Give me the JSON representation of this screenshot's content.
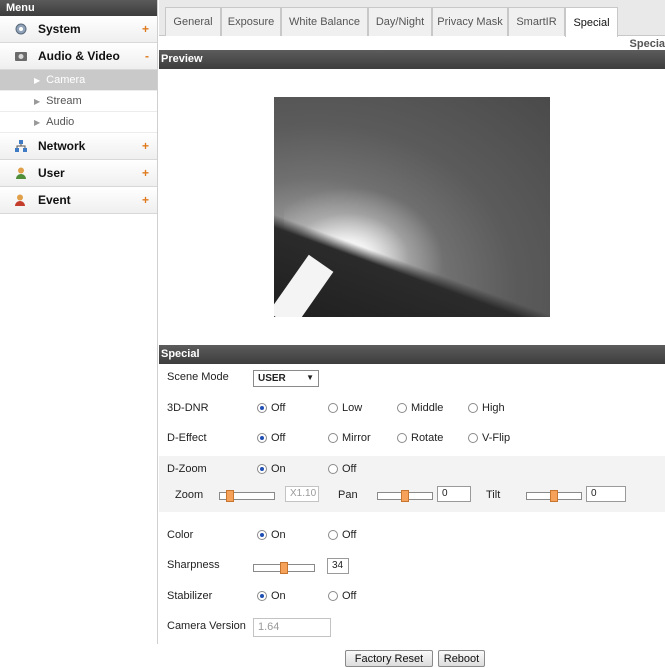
{
  "sidebar": {
    "title": "Menu",
    "items": [
      {
        "label": "System",
        "icon": "gear-icon",
        "sign": "+"
      },
      {
        "label": "Audio & Video",
        "icon": "camera-icon",
        "sign": "-"
      },
      {
        "label": "Network",
        "icon": "network-icon",
        "sign": "+"
      },
      {
        "label": "User",
        "icon": "user-icon",
        "sign": "+"
      },
      {
        "label": "Event",
        "icon": "event-icon",
        "sign": "+"
      }
    ],
    "subitems": [
      "Camera",
      "Stream",
      "Audio"
    ]
  },
  "tabs": [
    "General",
    "Exposure",
    "White Balance",
    "Day/Night",
    "Privacy Mask",
    "SmartIR",
    "Special"
  ],
  "page_title": "Specia",
  "preview": {
    "title": "Preview"
  },
  "special": {
    "title": "Special",
    "scene_mode": {
      "label": "Scene Mode",
      "value": "USER"
    },
    "dnr": {
      "label": "3D-DNR",
      "options": [
        "Off",
        "Low",
        "Middle",
        "High"
      ]
    },
    "deffect": {
      "label": "D-Effect",
      "options": [
        "Off",
        "Mirror",
        "Rotate",
        "V-Flip"
      ]
    },
    "dzoom": {
      "label": "D-Zoom",
      "on": "On",
      "off": "Off"
    },
    "zoom": {
      "label": "Zoom",
      "value": "X1.10",
      "level": 0.12
    },
    "pan": {
      "label": "Pan",
      "value": "0",
      "level": 0.5
    },
    "tilt": {
      "label": "Tilt",
      "value": "0",
      "level": 0.5
    },
    "color": {
      "label": "Color",
      "on": "On",
      "off": "Off"
    },
    "sharpness": {
      "label": "Sharpness",
      "value": "34",
      "level": 0.5
    },
    "stabilizer": {
      "label": "Stabilizer",
      "on": "On",
      "off": "Off"
    },
    "camera_version": {
      "label": "Camera Version",
      "value": "1.64"
    },
    "factory_reset": "Factory Reset",
    "reboot": "Reboot"
  }
}
